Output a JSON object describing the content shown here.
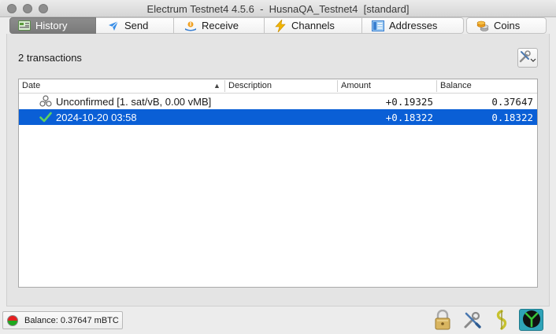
{
  "window": {
    "title": "Electrum Testnet4 4.5.6  -  HusnaQA_Testnet4  [standard]"
  },
  "tabs": [
    {
      "label": "History",
      "icon": "history-icon",
      "active": true
    },
    {
      "label": "Send",
      "icon": "send-icon",
      "active": false
    },
    {
      "label": "Receive",
      "icon": "receive-icon",
      "active": false
    },
    {
      "label": "Channels",
      "icon": "lightning-icon",
      "active": false
    },
    {
      "label": "Addresses",
      "icon": "addresses-icon",
      "active": false
    },
    {
      "label": "Coins",
      "icon": "coins-icon",
      "active": false
    }
  ],
  "history": {
    "count_label": "2 transactions",
    "columns": [
      "Date",
      "Description",
      "Amount",
      "Balance"
    ],
    "rows": [
      {
        "date": "Unconfirmed [1. sat/vB, 0.00 vMB]",
        "description": "",
        "amount": "+0.19325",
        "balance": "0.37647",
        "status_icon": "unconfirmed-icon",
        "selected": false
      },
      {
        "date": "2024-10-20 03:58",
        "description": "",
        "amount": "+0.18322",
        "balance": "0.18322",
        "status_icon": "confirmed-check-icon",
        "selected": true
      }
    ]
  },
  "statusbar": {
    "balance_text": "Balance: 0.37647 mBTC",
    "icons": [
      "lock-icon",
      "tools-icon",
      "seed-icon",
      "network-icon"
    ]
  },
  "colors": {
    "selection": "#0a5fd6",
    "active_tab": "#858585",
    "network_status": "#2fa3b8"
  }
}
